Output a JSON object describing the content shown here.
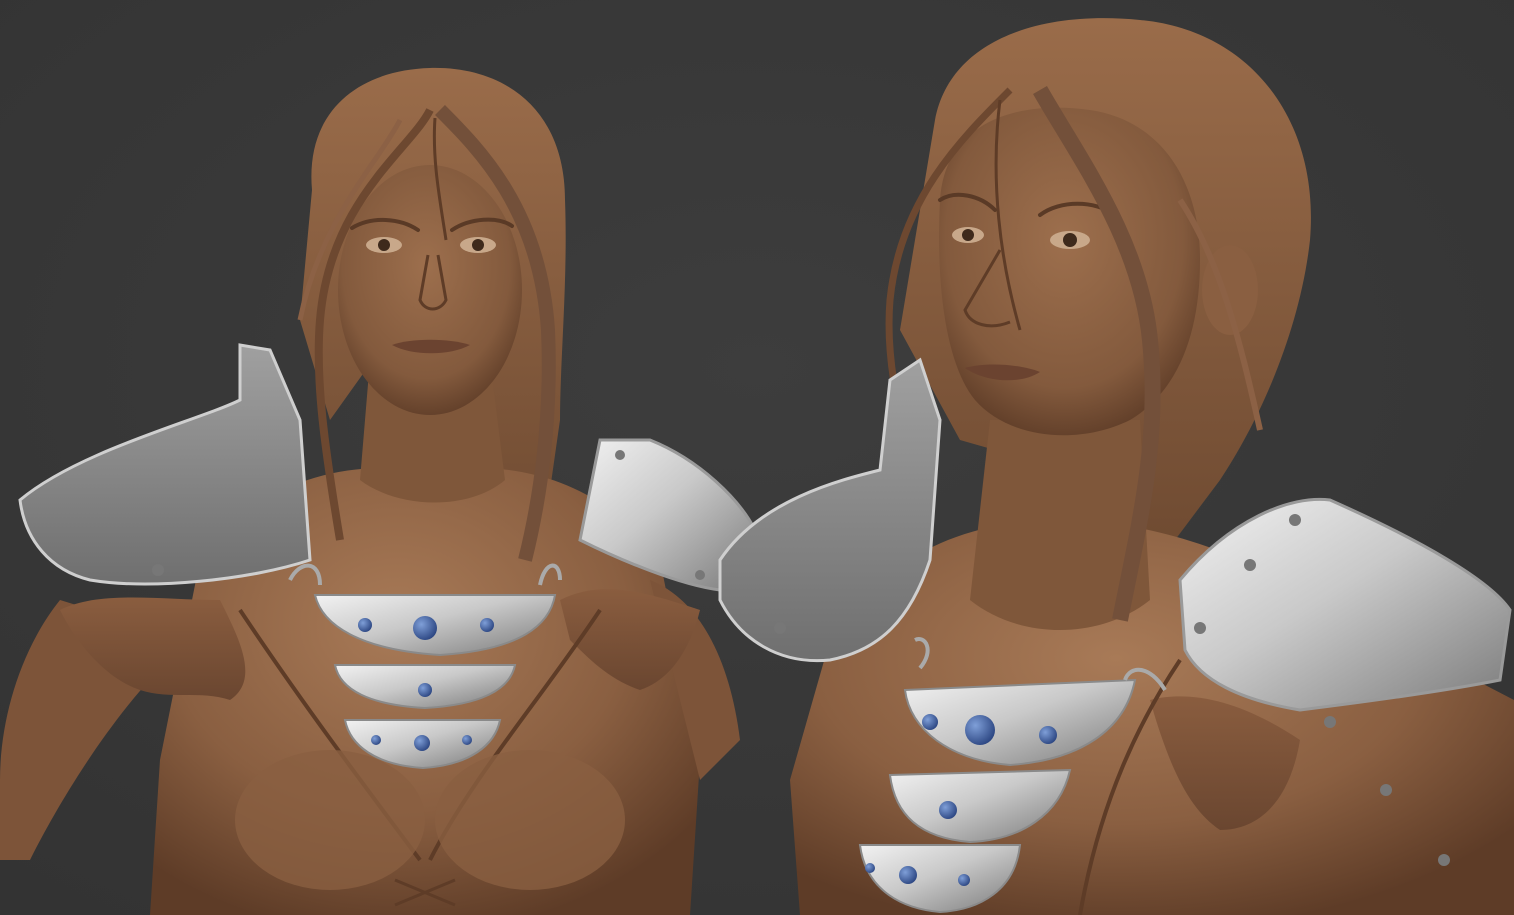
{
  "viewport": {
    "background": "#3a3a3a"
  },
  "materials": {
    "skin": "#8a5f41",
    "skin_shadow": "#5e3c27",
    "skin_highlight": "#a87a57",
    "leather": "#80563a",
    "metal": "#b9b9b9",
    "metal_light": "#f2f2f2",
    "metal_dark": "#6f6f6f",
    "gem": "#3c5a9a"
  },
  "figures": [
    {
      "name": "front-view-bust",
      "view": "front"
    },
    {
      "name": "three-quarter-view-bust",
      "view": "three-quarter"
    }
  ]
}
